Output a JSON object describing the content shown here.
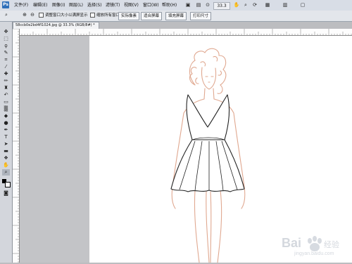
{
  "app": {
    "logo_text": "Ps"
  },
  "menu": [
    {
      "name": "file",
      "label": "文件(F)"
    },
    {
      "name": "edit",
      "label": "编辑(E)"
    },
    {
      "name": "image",
      "label": "图像(I)"
    },
    {
      "name": "layer",
      "label": "图层(L)"
    },
    {
      "name": "select",
      "label": "选择(S)"
    },
    {
      "name": "filter",
      "label": "滤镜(T)"
    },
    {
      "name": "view",
      "label": "视图(V)"
    },
    {
      "name": "window",
      "label": "窗口(W)"
    },
    {
      "name": "help",
      "label": "帮助(H)"
    }
  ],
  "toolbar": {
    "zoom_level": "33.3"
  },
  "options": {
    "resize_windows_label": "调整窗口大小以满屏显示",
    "zoom_all_windows_label": "缩放所有窗口",
    "actual_pixels_label": "实际像素",
    "fit_screen_label": "适合屏幕",
    "fill_screen_label": "填充屏幕",
    "print_size_label": "打印尺寸"
  },
  "document": {
    "tab_title": "58ccb0e2bd4fl1024.jpg @ 33.3% (RGB/8#) *"
  },
  "icons": {
    "move": "move-icon",
    "marquee": "marquee-icon",
    "lasso": "lasso-icon",
    "zoom": "zoom-icon",
    "hand": "hand-icon"
  },
  "colors": {
    "menu_bg": "#d8dde6",
    "canvas_bg": "#ffffff",
    "workspace_bg": "#bcbdc0",
    "sketch_outline": "#e0a890",
    "dress_ink": "#222222"
  },
  "watermark": {
    "brand": "Bai",
    "brand_suffix": "经验",
    "url": "jingyan.baidu.com"
  }
}
